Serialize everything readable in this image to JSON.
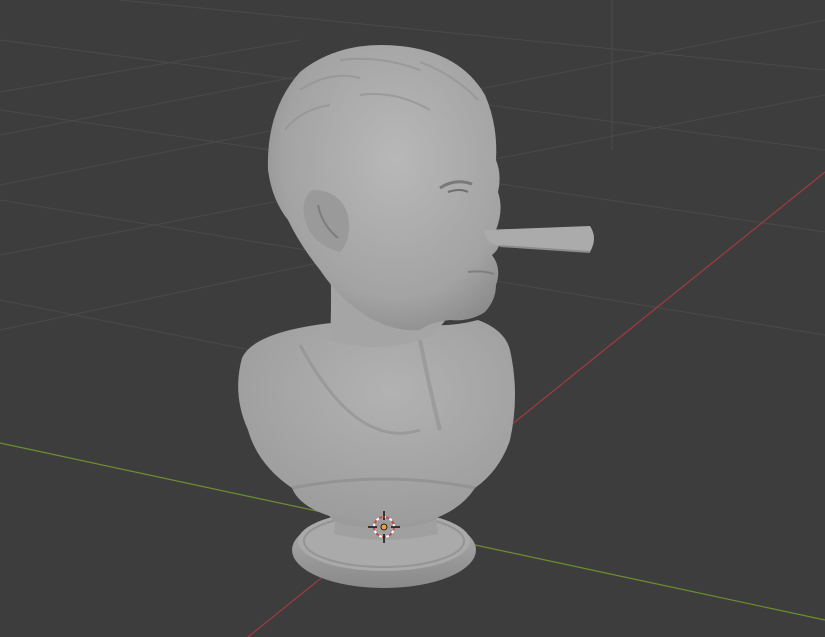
{
  "viewport": {
    "background": "#3d3d3d",
    "grid_color": "#4a4a4a",
    "x_axis_color": "#a23a43",
    "y_axis_color": "#6e8e2f",
    "model_color": "#a7a7a7"
  },
  "objects": [
    {
      "name": "Bust",
      "type": "mesh"
    }
  ],
  "origin_marker": {
    "color": "#e8a23a"
  },
  "cursor_3d": {
    "ring_colors": [
      "#c94a4a",
      "#ffffff"
    ]
  }
}
